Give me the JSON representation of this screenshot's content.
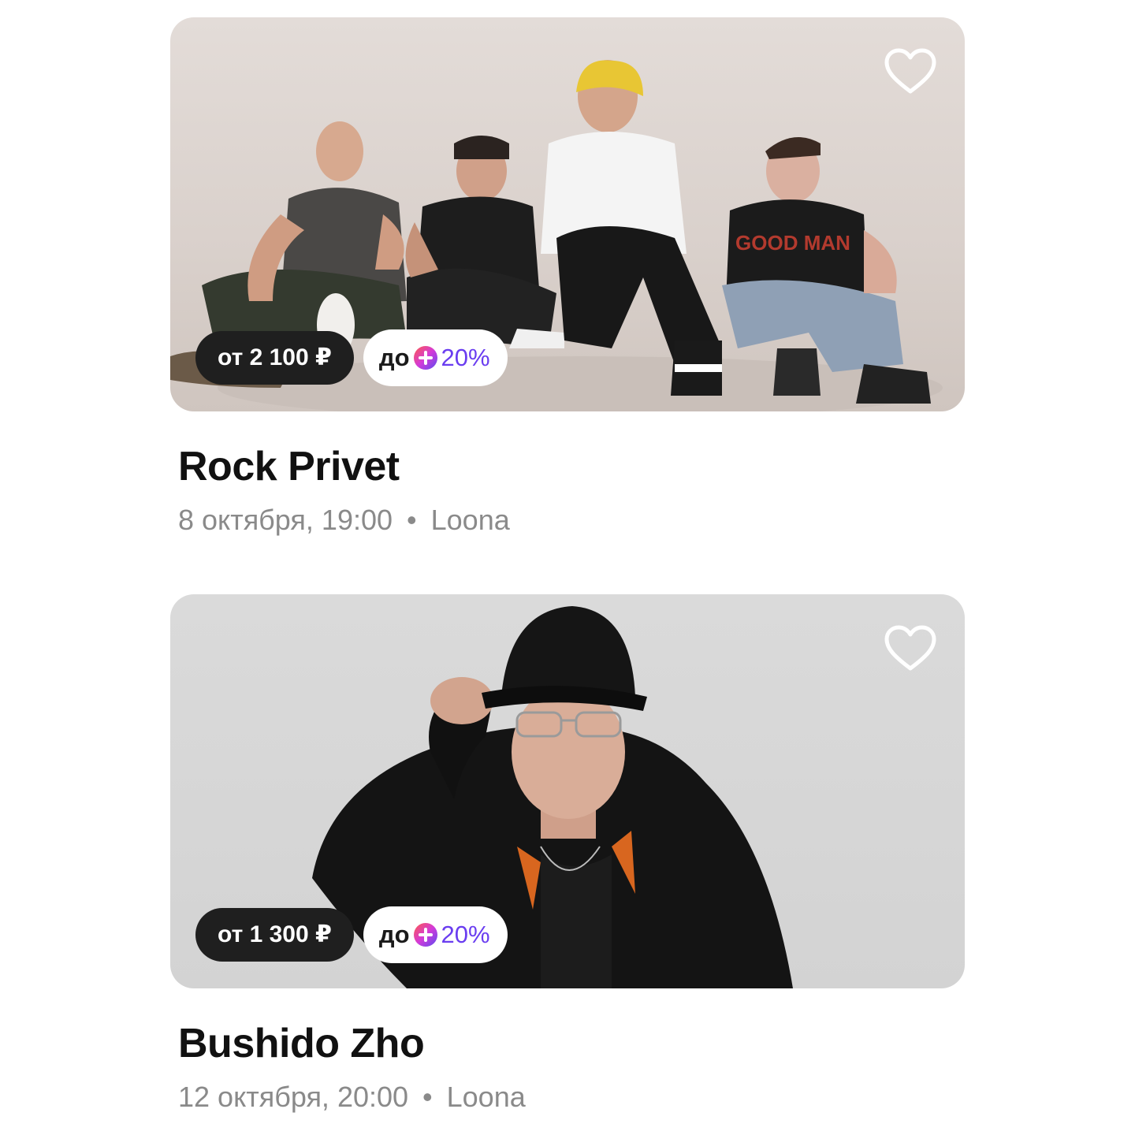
{
  "events": [
    {
      "title": "Rock Privet",
      "date_time": "8 октября, 19:00",
      "separator": "•",
      "venue": "Loona",
      "price": "от 2 100 ₽",
      "plus_prefix": "до",
      "plus_value": "20%",
      "favorite_icon": "heart-outline-icon",
      "shirt_print": "GOOD MAN"
    },
    {
      "title": "Bushido Zho",
      "date_time": "12 октября, 20:00",
      "separator": "•",
      "venue": "Loona",
      "price": "от 1 300 ₽",
      "plus_prefix": "до",
      "plus_value": "20%",
      "favorite_icon": "heart-outline-icon"
    }
  ],
  "colors": {
    "price_badge_bg": "#1f1f1f",
    "plus_accent": "#6a3df0",
    "meta_text": "#8a8a8a"
  }
}
